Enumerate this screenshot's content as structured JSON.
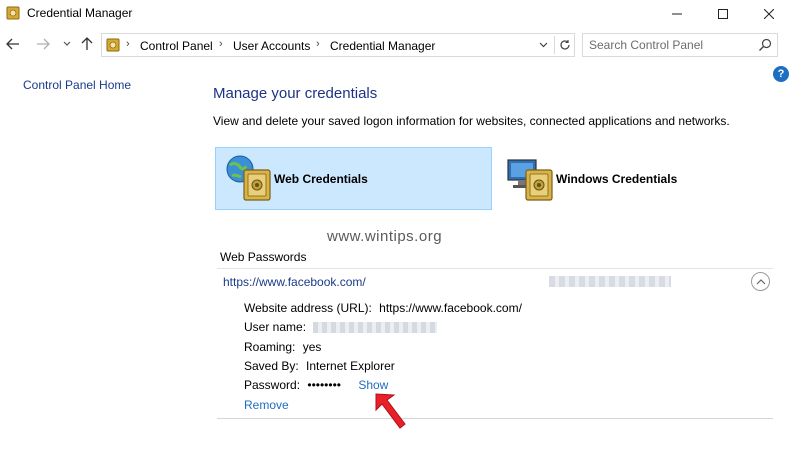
{
  "window": {
    "title": "Credential Manager",
    "controls": {
      "minimize": "minimize-icon",
      "maximize": "maximize-icon",
      "close": "close-icon"
    }
  },
  "address_bar": {
    "breadcrumbs": [
      "Control Panel",
      "User Accounts",
      "Credential Manager"
    ],
    "search_placeholder": "Search Control Panel"
  },
  "sidebar": {
    "home_link": "Control Panel Home"
  },
  "main": {
    "title": "Manage your credentials",
    "description": "View and delete your saved logon information for websites, connected applications and networks.",
    "tabs": [
      {
        "label": "Web Credentials",
        "selected": true
      },
      {
        "label": "Windows Credentials",
        "selected": false
      }
    ],
    "watermark": "www.wintips.org",
    "section_heading": "Web Passwords",
    "entry": {
      "url": "https://www.facebook.com/",
      "details": {
        "website_label": "Website address (URL):",
        "website_value": "https://www.facebook.com/",
        "username_label": "User name:",
        "roaming_label": "Roaming:",
        "roaming_value": "yes",
        "savedby_label": "Saved By:",
        "savedby_value": "Internet Explorer",
        "password_label": "Password:",
        "password_value": "••••••••",
        "show_label": "Show"
      },
      "remove_label": "Remove"
    }
  },
  "colors": {
    "accent_link": "#1e6fc0",
    "title_blue": "#1e3287",
    "selected_tile": "#cce8ff",
    "arrow_red": "#e8202a"
  }
}
